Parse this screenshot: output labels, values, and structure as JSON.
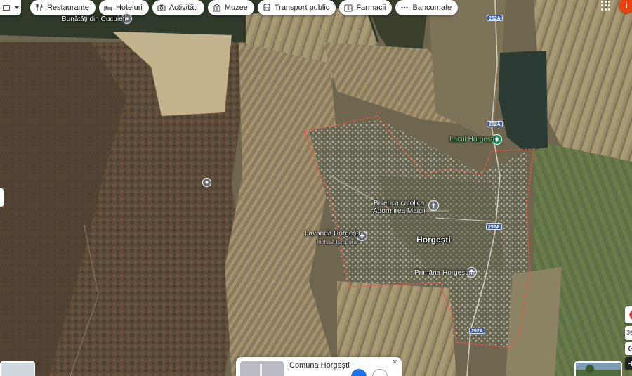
{
  "chips": [
    {
      "label": "Restaurante",
      "icon": "fork-knife-icon"
    },
    {
      "label": "Hoteluri",
      "icon": "bed-icon"
    },
    {
      "label": "Activități",
      "icon": "camera-icon"
    },
    {
      "label": "Muzee",
      "icon": "museum-icon"
    },
    {
      "label": "Transport public",
      "icon": "bus-icon"
    },
    {
      "label": "Farmacii",
      "icon": "pharmacy-icon"
    },
    {
      "label": "Bancomate",
      "icon": "atm-icon"
    }
  ],
  "account_initial": "i",
  "places": {
    "bunatati": "Bunătăți din Cucuieți",
    "lacul": "Lacul Horgești",
    "biserica_line1": "Biserica catolica",
    "biserica_line2": "Adormirea Maicii",
    "lavanda": "Lavandă Horgești",
    "lavanda_status": "Închisă temporar",
    "village": "Horgești",
    "primaria": "Primăria Horgești"
  },
  "road_label": "252A",
  "right_controls": {
    "zoom_value": "3€"
  },
  "place_card": {
    "title": "Comuna Horgești",
    "close_label": "×"
  },
  "colors": {
    "boundary": "#e8574b",
    "pin_green": "#1e8e5a",
    "pin_grey": "#6b6e75",
    "account": "#e8430f"
  }
}
